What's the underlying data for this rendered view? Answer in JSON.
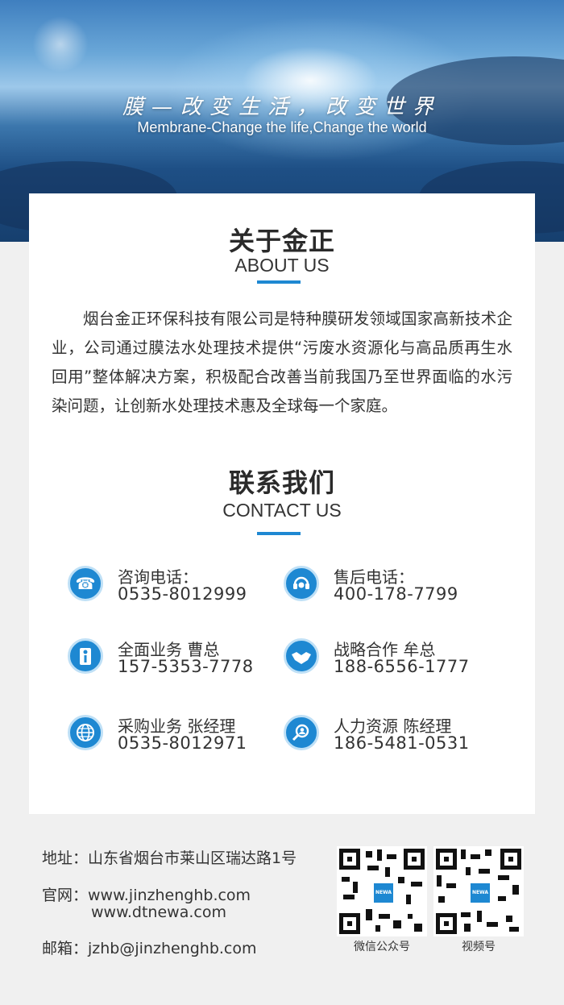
{
  "hero": {
    "slogan_cn": "膜—改变生活，改变世界",
    "slogan_en": "Membrane-Change the life,Change the world"
  },
  "about": {
    "title_cn": "关于金正",
    "title_en": "ABOUT US",
    "text": "烟台金正环保科技有限公司是特种膜研发领域国家高新技术企业，公司通过膜法水处理技术提供“污废水资源化与高品质再生水回用”整体解决方案，积极配合改善当前我国乃至世界面临的水污染问题，让创新水处理技术惠及全球每一个家庭。"
  },
  "contact": {
    "title_cn": "联系我们",
    "title_en": "CONTACT US",
    "items": [
      {
        "label": "咨询电话：",
        "value": "0535-8012999",
        "icon": "telephone-icon"
      },
      {
        "label": "售后电话：",
        "value": "400-178-7799",
        "icon": "headset-icon"
      },
      {
        "label": "全面业务 曹总",
        "value": "157-5353-7778",
        "icon": "businessman-icon"
      },
      {
        "label": "战略合作 牟总",
        "value": "188-6556-1777",
        "icon": "handshake-icon"
      },
      {
        "label": "采购业务 张经理",
        "value": "0535-8012971",
        "icon": "globe-icon"
      },
      {
        "label": "人力资源 陈经理",
        "value": "186-5481-0531",
        "icon": "person-search-icon"
      }
    ],
    "accent_color": "#1e88d2"
  },
  "footer": {
    "address_label": "地址：",
    "address": "山东省烟台市莱山区瑞达路1号",
    "website_label": "官网：",
    "website1": "www.jinzhenghb.com",
    "website2": "www.dtnewa.com",
    "email_label": "邮箱：",
    "email": "jzhb@jinzhenghb.com",
    "qr1_caption": "微信公众号",
    "qr2_caption": "视频号",
    "qr_logo_text": "NEWA"
  }
}
